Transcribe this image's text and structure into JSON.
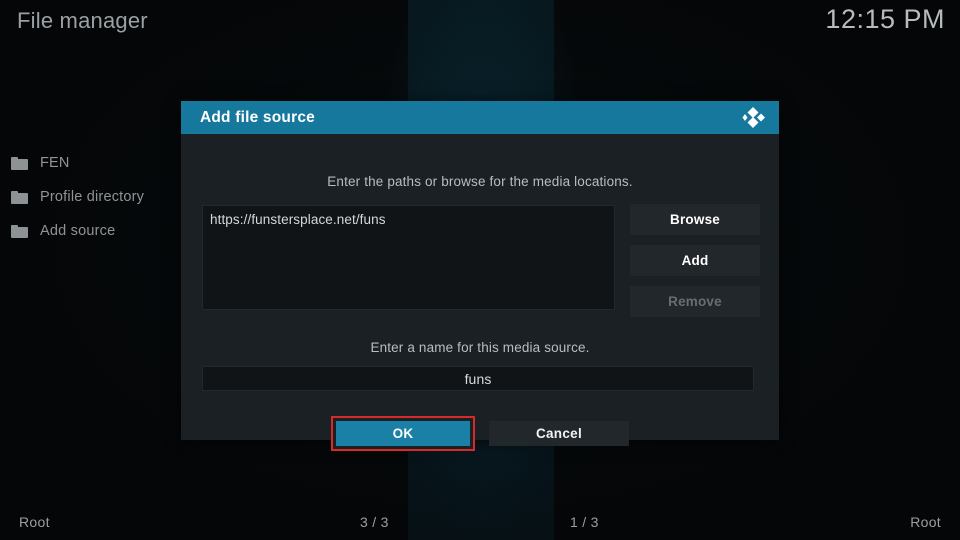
{
  "header": {
    "app_title": "File manager",
    "clock": "12:15 PM"
  },
  "sidebar": {
    "items": [
      {
        "label": "FEN",
        "icon": "folder-icon"
      },
      {
        "label": "Profile directory",
        "icon": "folder-icon"
      },
      {
        "label": "Add source",
        "icon": "folder-icon"
      }
    ]
  },
  "dialog": {
    "title": "Add file source",
    "logo_icon": "kodi-logo-icon",
    "paths_hint": "Enter the paths or browse for the media locations.",
    "path_entries": [
      "https://funstersplace.net/funs"
    ],
    "buttons": {
      "browse": "Browse",
      "add": "Add",
      "remove": "Remove"
    },
    "remove_disabled": true,
    "name_hint": "Enter a name for this media source.",
    "name_value": "funs",
    "ok_label": "OK",
    "cancel_label": "Cancel",
    "focused_button": "OK",
    "colors": {
      "header": "#16789c",
      "ok_button": "#1a80a6",
      "focus_outline": "#d72b2b",
      "dialog_bg": "#1b2024"
    }
  },
  "statusbar": {
    "left": "Root",
    "left_count": "3 / 3",
    "right_count": "1 / 3",
    "right": "Root"
  }
}
